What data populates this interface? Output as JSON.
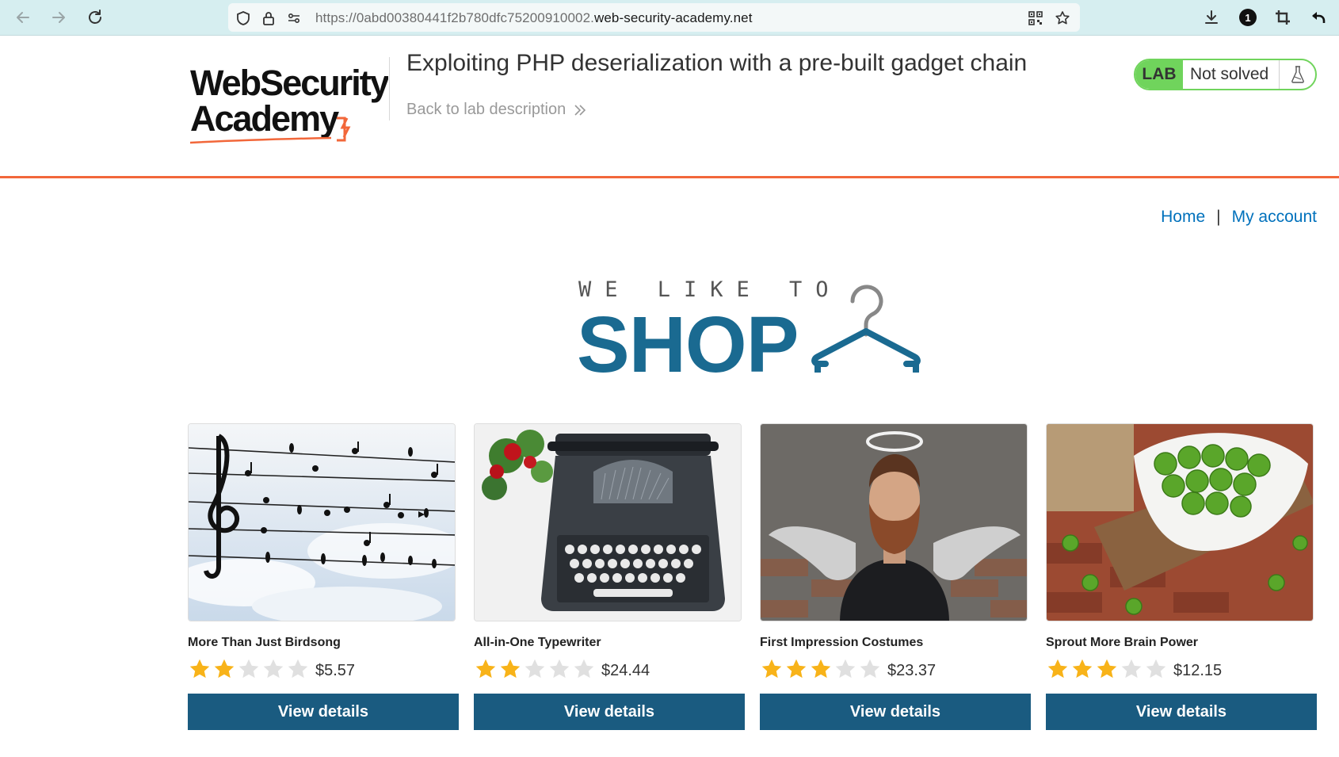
{
  "browser": {
    "url_prefix": "https://0abd00380441f2b780dfc75200910002.",
    "url_domain": "web-security-academy.net",
    "downloads_badge": "1"
  },
  "lab": {
    "logo_line1": "WebSecurity",
    "logo_line2": "Academy",
    "title": "Exploiting PHP deserialization with a pre-built gadget chain",
    "back_link": "Back to lab description",
    "status_tag": "LAB",
    "status_text": "Not solved"
  },
  "nav": {
    "home": "Home",
    "separator": "|",
    "account": "My account"
  },
  "hero": {
    "small": "WE LIKE TO",
    "big": "SHOP"
  },
  "products": [
    {
      "name": "More Than Just Birdsong",
      "rating": 2,
      "price": "$5.57",
      "button": "View details"
    },
    {
      "name": "All-in-One Typewriter",
      "rating": 2,
      "price": "$24.44",
      "button": "View details"
    },
    {
      "name": "First Impression Costumes",
      "rating": 3,
      "price": "$23.37",
      "button": "View details"
    },
    {
      "name": "Sprout More Brain Power",
      "rating": 3,
      "price": "$12.15",
      "button": "View details"
    }
  ],
  "colors": {
    "accent_orange": "#f2673a",
    "lab_green": "#70d45c",
    "button_blue": "#1a5b80",
    "link_blue": "#0071bc",
    "star_gold": "#f8b319",
    "star_gray": "#e0e0e0"
  }
}
